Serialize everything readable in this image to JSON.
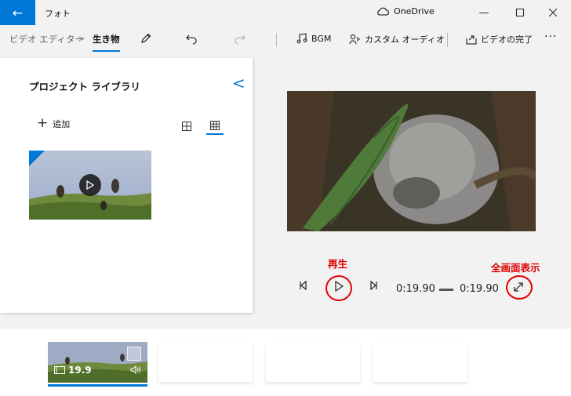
{
  "titlebar": {
    "app_title": "フォト",
    "onedrive_label": "OneDrive",
    "back_icon": "back-arrow-icon",
    "colors": {
      "accent": "#0078d7"
    }
  },
  "toolbar": {
    "breadcrumb_parent": "ビデオ エディター",
    "breadcrumb_sep": ">",
    "breadcrumb_current": "生き物",
    "bgm_label": "BGM",
    "custom_audio_label": "カスタム オーディオ",
    "finish_label": "ビデオの完了",
    "more_label": "···"
  },
  "library": {
    "title": "プロジェクト ライブラリ",
    "add_label": "追加",
    "collapse_glyph": "<"
  },
  "annotations": {
    "play_label": "再生",
    "fullscreen_label": "全画面表示",
    "color": "#e00000"
  },
  "playback": {
    "current_time": "0:19.90",
    "total_time": "0:19.90"
  },
  "storyboard": {
    "clip_duration": "19.9"
  }
}
